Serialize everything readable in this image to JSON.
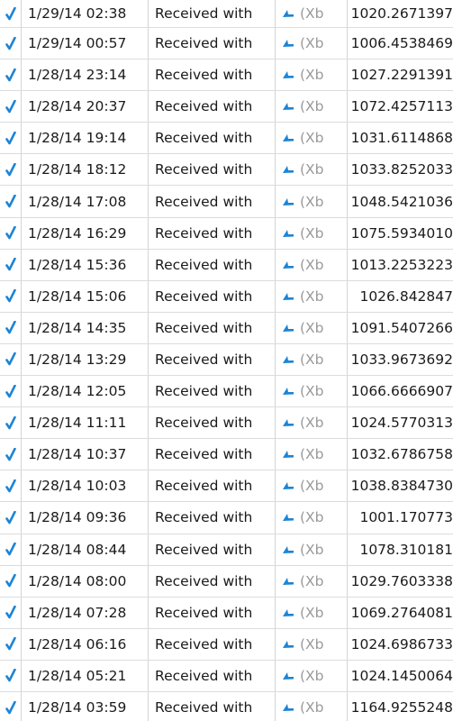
{
  "table": {
    "rows": [
      {
        "date": "1/29/14 02:38",
        "description": "Received with",
        "tag": "(Xb",
        "amount": "1020.2671397"
      },
      {
        "date": "1/29/14 00:57",
        "description": "Received with",
        "tag": "(Xb",
        "amount": "1006.4538469"
      },
      {
        "date": "1/28/14 23:14",
        "description": "Received with",
        "tag": "(Xb",
        "amount": "1027.2291391"
      },
      {
        "date": "1/28/14 20:37",
        "description": "Received with",
        "tag": "(Xb",
        "amount": "1072.4257113"
      },
      {
        "date": "1/28/14 19:14",
        "description": "Received with",
        "tag": "(Xb",
        "amount": "1031.6114868"
      },
      {
        "date": "1/28/14 18:12",
        "description": "Received with",
        "tag": "(Xb",
        "amount": "1033.8252033"
      },
      {
        "date": "1/28/14 17:08",
        "description": "Received with",
        "tag": "(Xb",
        "amount": "1048.5421036"
      },
      {
        "date": "1/28/14 16:29",
        "description": "Received with",
        "tag": "(Xb",
        "amount": "1075.5934010"
      },
      {
        "date": "1/28/14 15:36",
        "description": "Received with",
        "tag": "(Xb",
        "amount": "1013.2253223"
      },
      {
        "date": "1/28/14 15:06",
        "description": "Received with",
        "tag": "(Xb",
        "amount": "1026.842847"
      },
      {
        "date": "1/28/14 14:35",
        "description": "Received with",
        "tag": "(Xb",
        "amount": "1091.5407266"
      },
      {
        "date": "1/28/14 13:29",
        "description": "Received with",
        "tag": "(Xb",
        "amount": "1033.9673692"
      },
      {
        "date": "1/28/14 12:05",
        "description": "Received with",
        "tag": "(Xb",
        "amount": "1066.6666907"
      },
      {
        "date": "1/28/14 11:11",
        "description": "Received with",
        "tag": "(Xb",
        "amount": "1024.5770313"
      },
      {
        "date": "1/28/14 10:37",
        "description": "Received with",
        "tag": "(Xb",
        "amount": "1032.6786758"
      },
      {
        "date": "1/28/14 10:03",
        "description": "Received with",
        "tag": "(Xb",
        "amount": "1038.8384730"
      },
      {
        "date": "1/28/14 09:36",
        "description": "Received with",
        "tag": "(Xb",
        "amount": "1001.170773"
      },
      {
        "date": "1/28/14 08:44",
        "description": "Received with",
        "tag": "(Xb",
        "amount": "1078.310181"
      },
      {
        "date": "1/28/14 08:00",
        "description": "Received with",
        "tag": "(Xb",
        "amount": "1029.7603338"
      },
      {
        "date": "1/28/14 07:28",
        "description": "Received with",
        "tag": "(Xb",
        "amount": "1069.2764081"
      },
      {
        "date": "1/28/14 06:16",
        "description": "Received with",
        "tag": "(Xb",
        "amount": "1024.6986733"
      },
      {
        "date": "1/28/14 05:21",
        "description": "Received with",
        "tag": "(Xb",
        "amount": "1024.1450064"
      },
      {
        "date": "1/28/14 03:59",
        "description": "Received with",
        "tag": "(Xb",
        "amount": "1164.9255248"
      }
    ]
  },
  "icons": {
    "status": "checkmark-icon",
    "type": "receive-tag-icon"
  },
  "colors": {
    "accent": "#1e84d4",
    "tag_text": "#9a9a9a",
    "grid": "#dcdcdc"
  }
}
